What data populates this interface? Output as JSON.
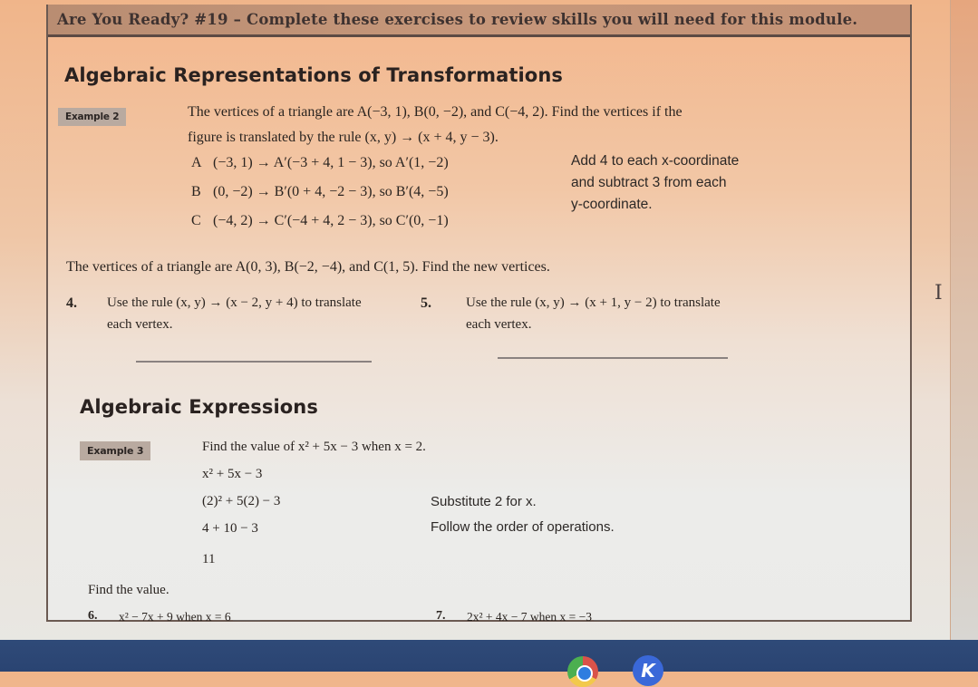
{
  "header": {
    "title": "Are You Ready? #19 – Complete these exercises to review skills you will need for this module."
  },
  "section1": {
    "heading": "Algebraic Representations of Transformations",
    "example_badge": "Example 2",
    "example_text_line1": "The vertices of a triangle are A(−3, 1), B(0, −2), and C(−4, 2). Find the vertices if the",
    "example_text_line2": "figure is translated by the rule (x, y) → (x + 4, y − 3).",
    "steps": [
      {
        "label": "A",
        "work": "(−3, 1) → A′(−3 + 4, 1 − 3), so A′(1, −2)"
      },
      {
        "label": "B",
        "work": "(0, −2) → B′(0 + 4, −2 − 3), so B′(4, −5)"
      },
      {
        "label": "C",
        "work": "(−4, 2) → C′(−4 + 4, 2 − 3), so C′(0, −1)"
      }
    ],
    "note_lines": [
      "Add 4 to each x-coordinate",
      "and subtract 3 from each",
      "y-coordinate."
    ],
    "prompt": "The vertices of a triangle are A(0, 3), B(−2, −4), and C(1, 5). Find the new vertices.",
    "exercises": [
      {
        "number": "4.",
        "line1": "Use the rule (x, y) → (x − 2, y + 4) to translate",
        "line2": "each vertex.",
        "answer": ""
      },
      {
        "number": "5.",
        "line1": "Use the rule (x, y) → (x + 1, y − 2) to translate",
        "line2": "each vertex.",
        "answer": ""
      }
    ]
  },
  "section2": {
    "heading": "Algebraic Expressions",
    "example_badge": "Example 3",
    "example_text": "Find the value of x² + 5x − 3 when x = 2.",
    "steps": [
      {
        "work": "x² + 5x − 3",
        "note": ""
      },
      {
        "work": "(2)² + 5(2) − 3",
        "note": "Substitute 2 for x."
      },
      {
        "work": "4 + 10 − 3",
        "note": "Follow the order of operations."
      },
      {
        "work": "11",
        "note": ""
      }
    ],
    "prompt": "Find the value.",
    "exercises": [
      {
        "number": "6.",
        "expression": "x² − 7x + 9 when x = 6",
        "answer": ""
      },
      {
        "number": "7.",
        "expression": "2x² + 4x − 7 when x = −3",
        "answer": ""
      }
    ]
  },
  "taskbar": {
    "apps": [
      {
        "name": "chrome-icon",
        "label": ""
      },
      {
        "name": "k-app-icon",
        "label": "K"
      }
    ]
  },
  "cursor": {
    "icon": "text-cursor-icon",
    "glyph": "I"
  }
}
